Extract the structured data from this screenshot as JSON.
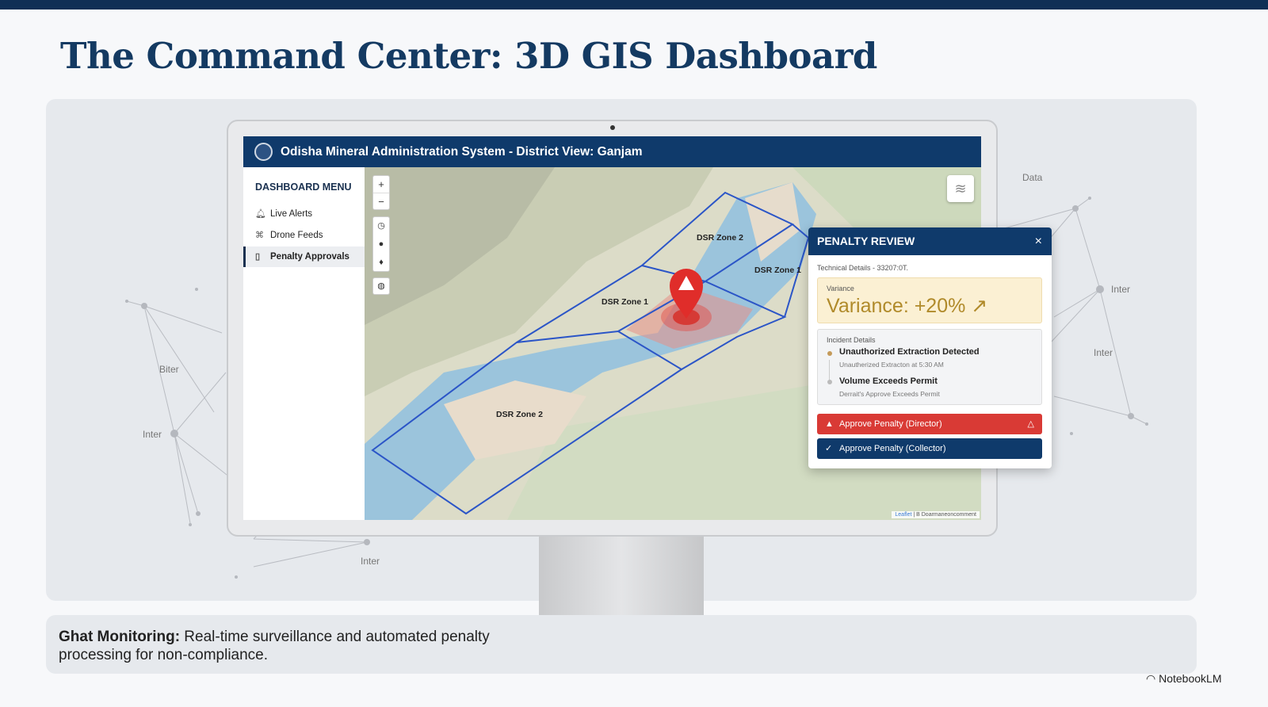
{
  "slide": {
    "title": "The Command Center: 3D GIS Dashboard",
    "caption_bold": "Ghat Monitoring:",
    "caption_text": " Real-time surveillance and automated penalty processing for non-compliance.",
    "brand": "NotebookLM",
    "network_labels": [
      "Data",
      "Inter",
      "Inter",
      "Biter",
      "Inter",
      "Inter"
    ]
  },
  "app": {
    "title": "Odisha Mineral Administration System - District View: Ganjam"
  },
  "sidebar": {
    "heading": "DASHBOARD MENU",
    "items": [
      {
        "label": "Live Alerts",
        "icon": "bell-icon"
      },
      {
        "label": "Drone Feeds",
        "icon": "drone-icon"
      },
      {
        "label": "Penalty Approvals",
        "icon": "document-icon",
        "active": true
      }
    ]
  },
  "map": {
    "zoom_in": "+",
    "zoom_out": "−",
    "zones": [
      "DSR Zone 2",
      "DSR Zone 1",
      "DSR Zone 1",
      "DSR Zone 2"
    ],
    "attribution_link": "Leaflet",
    "attribution_text": " | B Doarmaneoncomment"
  },
  "popup": {
    "title": "PENALTY REVIEW",
    "close": "×",
    "technical": "Technical Details - 33207:0T.",
    "variance_label": "Variance",
    "variance_value": "Variance: +20% ↗",
    "incident_label": "Incident Details",
    "incidents": [
      {
        "title": "Unauthorized Extraction Detected",
        "sub": "Unautherized Extracton at 5:30 AM",
        "color": "#c49a5a"
      },
      {
        "title": "Volume Exceeds Permit",
        "sub": "Derrait's Approve Exceeds Permit",
        "color": "#bbbbbb"
      }
    ],
    "approve_director": "Approve Penalty (Director)",
    "approve_collector": "Approve Penalty (Collector)"
  },
  "colors": {
    "navy": "#0f3a6b",
    "danger": "#d93a35",
    "variance": "#b08a2a"
  }
}
